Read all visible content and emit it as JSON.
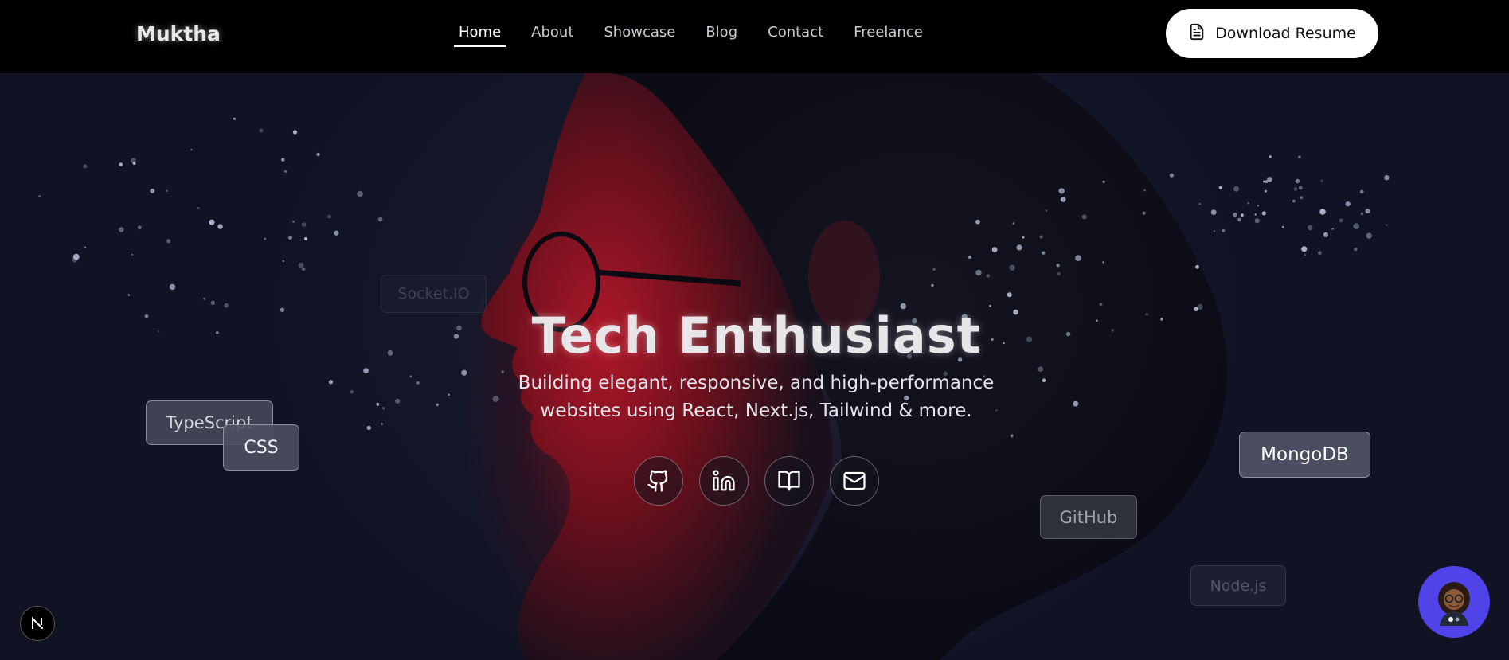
{
  "brand": {
    "name": "Muktha"
  },
  "nav": {
    "links": [
      {
        "label": "Home",
        "active": true
      },
      {
        "label": "About",
        "active": false
      },
      {
        "label": "Showcase",
        "active": false
      },
      {
        "label": "Blog",
        "active": false
      },
      {
        "label": "Contact",
        "active": false
      },
      {
        "label": "Freelance",
        "active": false
      }
    ],
    "resume_label": "Download Resume",
    "resume_icon": "file-text-icon"
  },
  "hero": {
    "title": "Tech Enthusiast",
    "subtitle": "Building elegant, responsive, and high-performance websites using React, Next.js, Tailwind & more.",
    "socials": [
      {
        "icon": "github-icon"
      },
      {
        "icon": "linkedin-icon"
      },
      {
        "icon": "book-open-icon"
      },
      {
        "icon": "mail-icon"
      }
    ]
  },
  "tech_tags": {
    "socketio": "Socket.IO",
    "typescript": "TypeScript",
    "css": "CSS",
    "mongodb": "MongoDB",
    "github": "GitHub",
    "nodejs": "Node.js"
  },
  "colors": {
    "background": "#101222",
    "accent_red": "#8c1220",
    "chat_button": "#5044e8",
    "nav_bg": "#000000"
  }
}
